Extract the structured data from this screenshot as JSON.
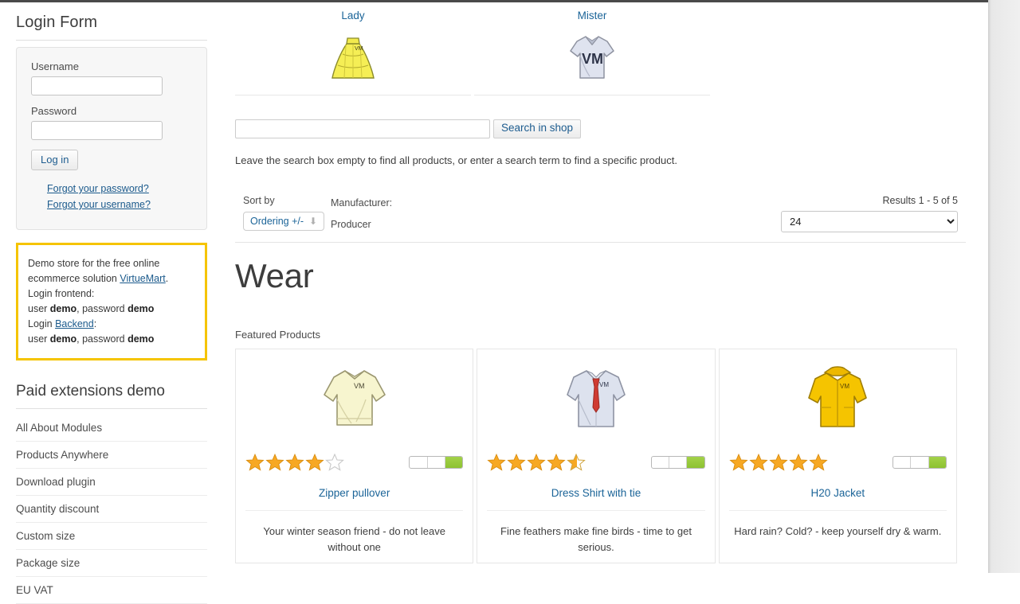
{
  "sidebar": {
    "login": {
      "title": "Login Form",
      "username_label": "Username",
      "username_value": "",
      "password_label": "Password",
      "password_value": "",
      "login_button": "Log in",
      "forgot_password": "Forgot your password?",
      "forgot_username": "Forgot your username?"
    },
    "notice": {
      "line1a": "Demo store for the free online",
      "line1b": "ecommerce solution ",
      "link_virtuemart": "VirtueMart",
      "line1c": ".",
      "line2": "Login frontend:",
      "line3_pre": "user ",
      "line3_user": "demo",
      "line3_mid": ", password ",
      "line3_pass": "demo",
      "line4_pre": "Login ",
      "link_backend": "Backend",
      "line4_post": ":",
      "line5_pre": "user ",
      "line5_user": "demo",
      "line5_mid": ", password ",
      "line5_pass": "demo",
      "border_color": "#f5c400"
    },
    "extensions": {
      "title": "Paid extensions demo",
      "items": [
        "All About Modules",
        "Products Anywhere",
        "Download plugin",
        "Quantity discount",
        "Custom size",
        "Package size",
        "EU VAT"
      ]
    }
  },
  "main": {
    "categories": [
      {
        "name": "Lady",
        "icon": "skirt-icon"
      },
      {
        "name": "Mister",
        "icon": "tshirt-icon"
      }
    ],
    "search": {
      "value": "",
      "placeholder": "",
      "button": "Search in shop",
      "hint": "Leave the search box empty to find all products, or enter a search term to find a specific product."
    },
    "toolbar": {
      "sort_by_label": "Sort by",
      "ordering_value": "Ordering +/-",
      "manufacturer_label": "Manufacturer:",
      "manufacturer_value": "Producer",
      "results_text": "Results 1 - 5 of 5",
      "per_page_value": "24",
      "per_page_options": [
        "24"
      ]
    },
    "page_title": "Wear",
    "featured_label": "Featured Products",
    "products": [
      {
        "name": "Zipper pullover",
        "description": "Your winter season friend - do not leave without one",
        "rating": 4,
        "rating_max": 5,
        "half_star": false,
        "stock_segments": 3,
        "stock_filled": 1,
        "icon": "pullover-icon"
      },
      {
        "name": "Dress Shirt with tie",
        "description": "Fine feathers make fine birds - time to get serious.",
        "rating": 4.5,
        "rating_max": 5,
        "half_star": true,
        "stock_segments": 3,
        "stock_filled": 1,
        "icon": "dress-shirt-icon"
      },
      {
        "name": "H20 Jacket",
        "description": "Hard rain? Cold? - keep yourself dry & warm.",
        "rating": 5,
        "rating_max": 5,
        "half_star": false,
        "stock_segments": 3,
        "stock_filled": 1,
        "icon": "jacket-icon"
      }
    ]
  },
  "colors": {
    "link": "#1b6498",
    "star_filled": "#f5a623",
    "star_empty": "#ffffff",
    "stock_green": "#8dc232",
    "notice_yellow": "#f5c400"
  }
}
